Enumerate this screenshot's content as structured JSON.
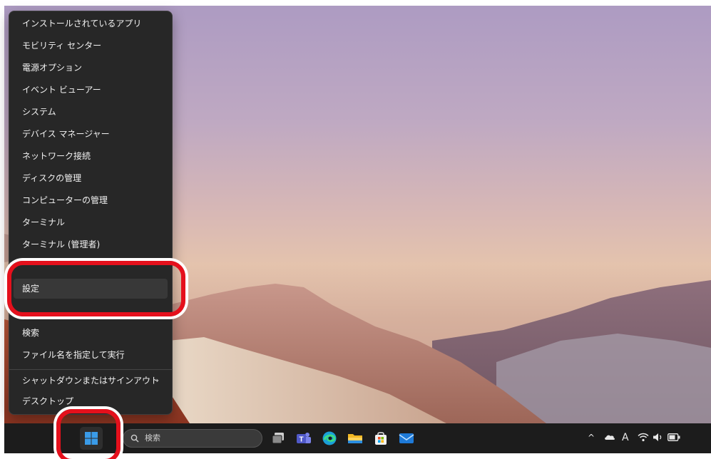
{
  "context_menu": {
    "items": [
      {
        "label": "インストールされているアプリ"
      },
      {
        "label": "モビリティ センター"
      },
      {
        "label": "電源オプション"
      },
      {
        "label": "イベント ビューアー"
      },
      {
        "label": "システム"
      },
      {
        "label": "デバイス マネージャー"
      },
      {
        "label": "ネットワーク接続"
      },
      {
        "label": "ディスクの管理"
      },
      {
        "label": "コンピューターの管理"
      },
      {
        "label": "ターミナル"
      },
      {
        "label": "ターミナル (管理者)"
      },
      {
        "label": "設定"
      },
      {
        "label": "検索"
      },
      {
        "label": "ファイル名を指定して実行"
      },
      {
        "label": "シャットダウンまたはサインアウト"
      },
      {
        "label": "デスクトップ"
      }
    ],
    "submenu_chevron": "›"
  },
  "taskbar": {
    "search_placeholder": "検索",
    "tray": {
      "chevron": "^",
      "ime_label": "A"
    }
  },
  "colors": {
    "menu_background": "#272727",
    "taskbar_background": "#1c1c1c",
    "highlight": "#e5101c",
    "windows_blue": "#3a9be8"
  },
  "icons": [
    "windows-start-icon",
    "search-icon",
    "task-view-icon",
    "teams-icon",
    "edge-icon",
    "file-explorer-icon",
    "microsoft-store-icon",
    "mail-icon",
    "chevron-up-icon",
    "onedrive-icon",
    "ime-icon",
    "wifi-icon",
    "speaker-icon",
    "battery-icon",
    "chevron-right-icon"
  ]
}
